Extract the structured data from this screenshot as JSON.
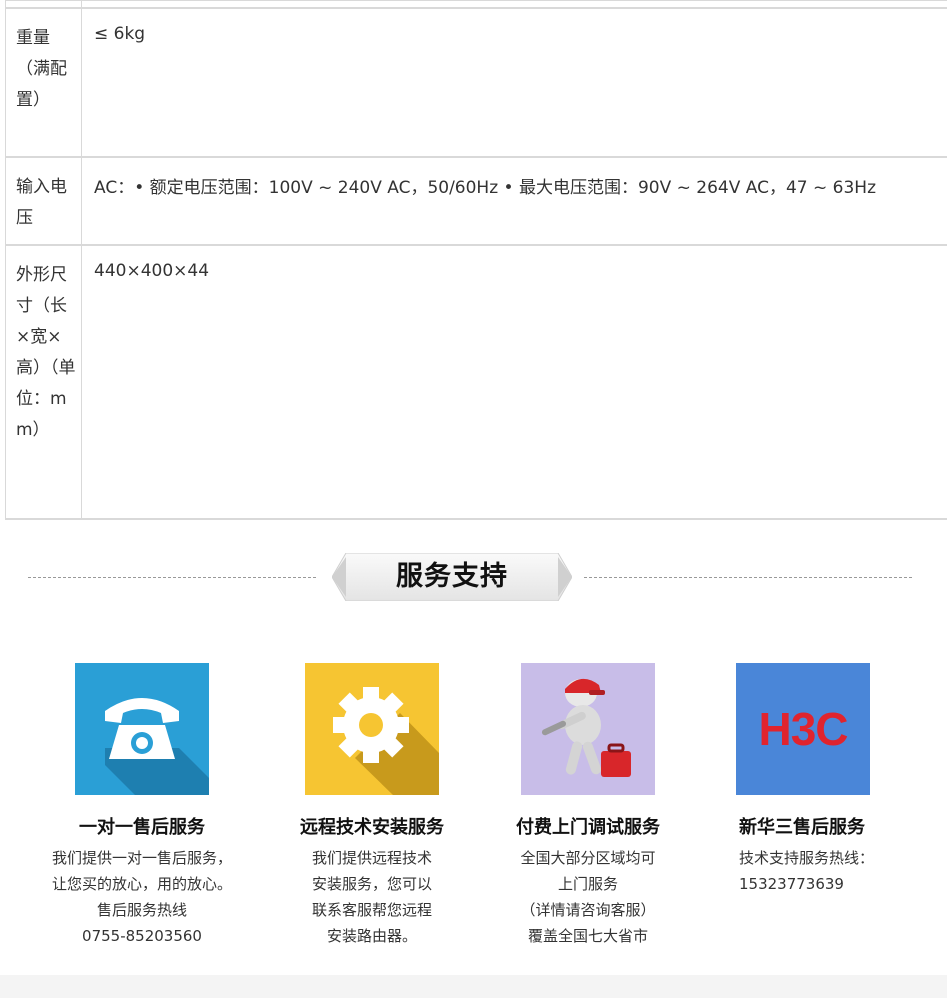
{
  "spec_rows": [
    {
      "label": "",
      "value": ""
    },
    {
      "label": "重量（满配置）",
      "value": "≤ 6kg"
    },
    {
      "label": "输入电压",
      "value": "AC：• 额定电压范围：100V ~ 240V AC，50/60Hz • 最大电压范围：90V ~ 264V AC，47 ~ 63Hz"
    },
    {
      "label": "外形尺寸（长×宽×高）（单位：mm）",
      "value": "440×400×44"
    }
  ],
  "service": {
    "title": "服务支持",
    "cards": [
      {
        "title": "一对一售后服务",
        "desc": "我们提供一对一售后服务，\n让您买的放心，用的放心。\n售后服务热线\n0755-85203560",
        "icon": "phone-icon",
        "color": "#2a9fd6"
      },
      {
        "title": "远程技术安装服务",
        "desc": "我们提供远程技术\n安装服务，您可以\n联系客服帮您远程\n安装路由器。",
        "icon": "gear-icon",
        "color": "#f6c532"
      },
      {
        "title": "付费上门调试服务",
        "desc": "全国大部分区域均可\n上门服务\n（详情请咨询客服）\n覆盖全国七大省市",
        "icon": "technician-icon",
        "color": "#c8bde8"
      },
      {
        "title": "新华三售后服务",
        "desc": "技术支持服务热线：\n15323773639",
        "icon": "h3c-logo",
        "logo_text": "H3C",
        "color": "#4a86d8"
      }
    ]
  }
}
